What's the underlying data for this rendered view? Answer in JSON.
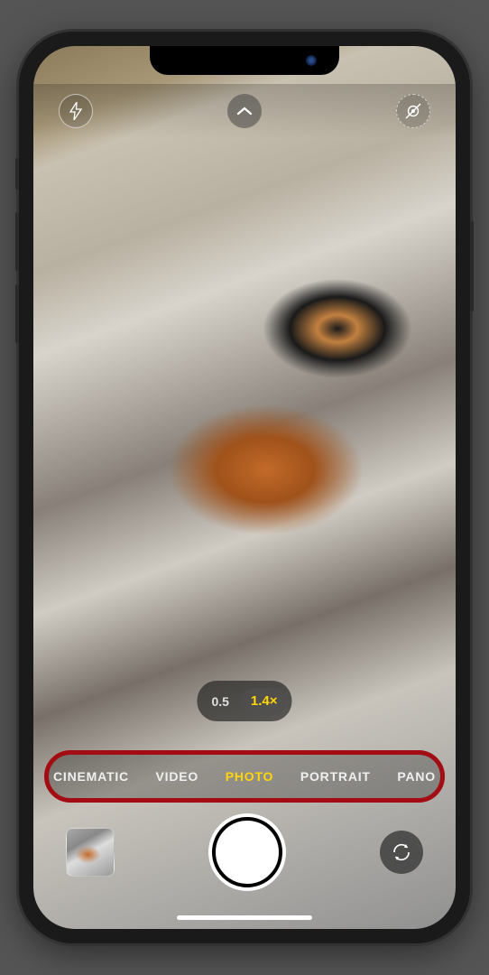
{
  "zoom": {
    "options": [
      "0.5",
      "1.4×"
    ],
    "active_index": 1
  },
  "modes": {
    "items": [
      "CINEMATIC",
      "VIDEO",
      "PHOTO",
      "PORTRAIT",
      "PANO"
    ],
    "active_index": 2
  },
  "icons": {
    "flash": "flash-icon",
    "chevron_up": "chevron-up-icon",
    "live_photo_off": "live-photo-off-icon",
    "camera_flip": "camera-flip-icon"
  }
}
